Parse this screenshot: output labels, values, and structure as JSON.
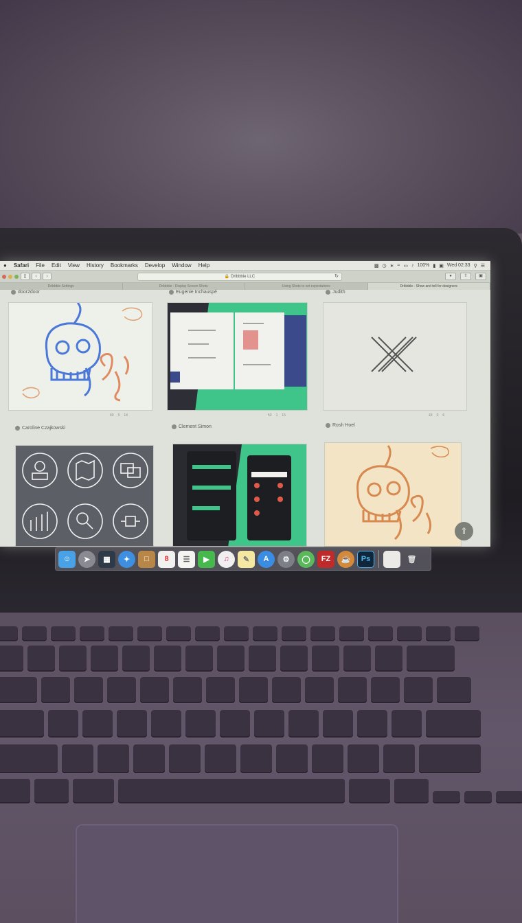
{
  "menubar": {
    "app": "Safari",
    "items": [
      "File",
      "Edit",
      "View",
      "History",
      "Bookmarks",
      "Develop",
      "Window",
      "Help"
    ],
    "battery": "100%",
    "clock": "Wed 02:33"
  },
  "toolbar": {
    "url": "Dribbble LLC",
    "lock_icon": "lock-icon"
  },
  "tabs": [
    {
      "label": "Dribbble Settings",
      "active": false
    },
    {
      "label": "Dribbble - Display Screen Shots",
      "active": false
    },
    {
      "label": "Using Shots to set expectations",
      "active": false
    },
    {
      "label": "Dribbble - Show and tell for designers",
      "active": true
    }
  ],
  "shots": [
    {
      "author": "door2door",
      "stats": [
        "60",
        "5",
        "14"
      ]
    },
    {
      "author": "Eugenie Inchauspé",
      "stats": [
        "53",
        "1",
        "15"
      ]
    },
    {
      "author": "Judith",
      "stats": [
        "43",
        "0",
        "6"
      ]
    },
    {
      "author": "Caroline Czajkowski",
      "stats": []
    },
    {
      "author": "Clement Simon",
      "stats": []
    },
    {
      "author": "Rosh Hoel",
      "stats": []
    }
  ],
  "dock": {
    "apps": [
      "Finder",
      "Launchpad",
      "Mission Control",
      "Safari",
      "Contacts",
      "Calendar",
      "Reminders",
      "FaceTime",
      "iTunes",
      "Notes",
      "App Store",
      "System Preferences",
      "Android Studio",
      "FileZilla",
      "Growl",
      "Photoshop"
    ],
    "calendar_day": "8",
    "filezilla_label": "FZ",
    "photoshop_label": "Ps"
  }
}
